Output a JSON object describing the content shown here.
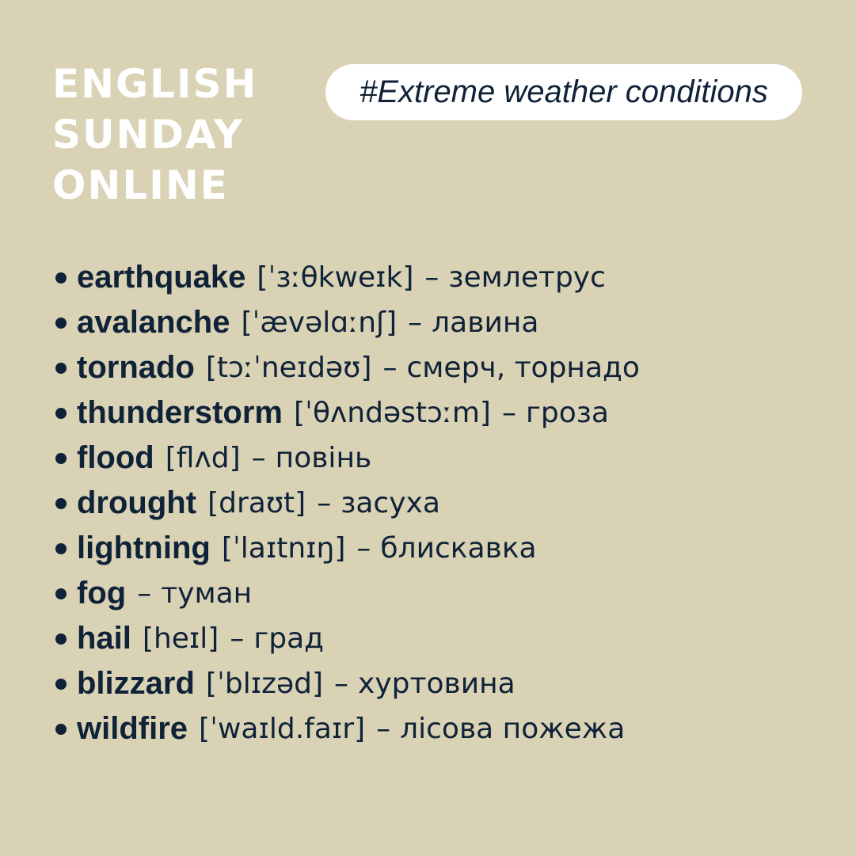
{
  "logo": {
    "lines": [
      "ENGLISH",
      "SUNDAY",
      "ONLINE"
    ]
  },
  "topic_tag": "#Extreme weather conditions",
  "vocabulary": [
    {
      "word": "earthquake",
      "ipa": "[ˈɜːθkweɪk]",
      "translation": "землетрус"
    },
    {
      "word": "avalanche",
      "ipa": "[ˈævəlɑːnʃ]",
      "translation": "лавина"
    },
    {
      "word": "tornado",
      "ipa": "[tɔːˈneɪdəʊ]",
      "translation": "смерч, торнадо"
    },
    {
      "word": "thunderstorm",
      "ipa": "[ˈθʌndəstɔːm]",
      "translation": "гроза"
    },
    {
      "word": "flood",
      "ipa": "[flʌd]",
      "translation": "повінь"
    },
    {
      "word": "drought",
      "ipa": "[draʊt]",
      "translation": "засуха"
    },
    {
      "word": "lightning",
      "ipa": "[ˈlaɪtnɪŋ]",
      "translation": "блискавка"
    },
    {
      "word": "fog",
      "ipa": "",
      "translation": "туман"
    },
    {
      "word": "hail",
      "ipa": "[heɪl]",
      "translation": "град"
    },
    {
      "word": "blizzard",
      "ipa": "[ˈblɪzəd]",
      "translation": "хуртовина"
    },
    {
      "word": "wildfire",
      "ipa": "[ˈwaɪld.faɪr]",
      "translation": "лісова пожежа"
    }
  ],
  "separator": "–",
  "colors": {
    "background": "#d9d2b5",
    "text": "#0f2238",
    "logo": "#ffffff",
    "tag_background": "#ffffff"
  }
}
